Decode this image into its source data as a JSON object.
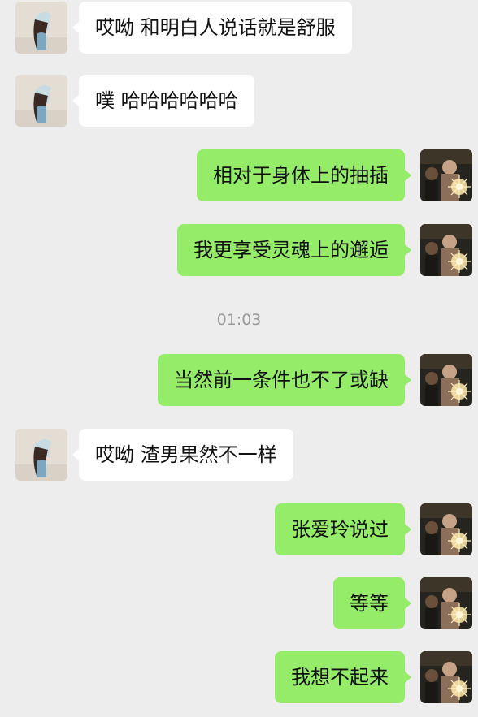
{
  "messages": [
    {
      "side": "left",
      "text": "哎呦 和明白人说话就是舒服"
    },
    {
      "side": "left",
      "text": "噗 哈哈哈哈哈哈"
    },
    {
      "side": "right",
      "text": "相对于身体上的抽插"
    },
    {
      "side": "right",
      "text": "我更享受灵魂上的邂逅"
    },
    {
      "side": "right",
      "text": "当然前一条件也不了或缺"
    },
    {
      "side": "left",
      "text": "哎呦 渣男果然不一样"
    },
    {
      "side": "right",
      "text": "张爱玲说过"
    },
    {
      "side": "right",
      "text": "等等"
    },
    {
      "side": "right",
      "text": "我想不起来"
    }
  ],
  "timestamp": "01:03",
  "colors": {
    "background": "#ededed",
    "incoming_bubble": "#ffffff",
    "outgoing_bubble": "#95ec69",
    "timestamp_text": "#9a9a9a"
  }
}
